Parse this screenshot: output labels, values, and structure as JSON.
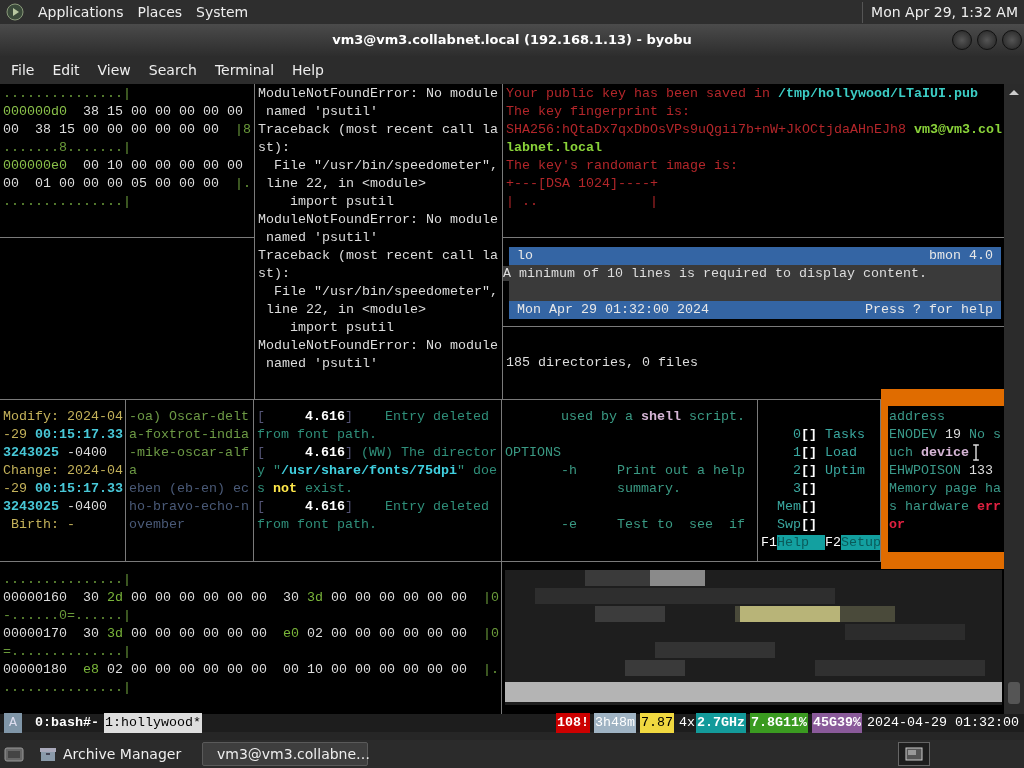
{
  "top_panel": {
    "menus": [
      "Applications",
      "Places",
      "System"
    ],
    "clock": "Mon Apr 29, 1:32 AM"
  },
  "window": {
    "title": "vm3@vm3.collabnet.local (192.168.1.13) - byobu"
  },
  "menu_bar": [
    "File",
    "Edit",
    "View",
    "Search",
    "Terminal",
    "Help"
  ],
  "panes": {
    "hexdump_top": {
      "lines": [
        "...............|",
        [
          {
            "text": "000000d0",
            "kind": "offset"
          },
          {
            "text": "  38 15 00 00 00 00 00",
            "kind": "hex"
          }
        ],
        [
          {
            "text": "00  38 15 00 00 00 00 00 00  ",
            "kind": "hex"
          },
          {
            "text": "|8",
            "kind": "ascii"
          }
        ],
        ".......8.......|",
        [
          {
            "text": "000000e0",
            "kind": "offset"
          },
          {
            "text": "  00 10 00 00 00 00 00",
            "kind": "hex"
          }
        ],
        [
          {
            "text": "00  01 00 00 00 05 00 00 00  ",
            "kind": "hex"
          },
          {
            "text": "|.",
            "kind": "ascii"
          }
        ],
        "...............|"
      ]
    },
    "python_errors": {
      "lines": [
        "ModuleNotFoundError: No module",
        " named 'psutil'",
        "Traceback (most recent call la",
        "st):",
        "  File \"/usr/bin/speedometer\",",
        " line 22, in <module>",
        "    import psutil",
        "ModuleNotFoundError: No module",
        " named 'psutil'",
        "Traceback (most recent call la",
        "st):",
        "  File \"/usr/bin/speedometer\",",
        " line 22, in <module>",
        "    import psutil",
        "ModuleNotFoundError: No module",
        " named 'psutil'"
      ]
    },
    "ssh_keygen": {
      "lines": [
        [
          {
            "text": "Your public key has been saved in ",
            "kind": "message"
          },
          {
            "text": "/tmp/hollywood/LTaIUI.pub",
            "kind": "path"
          }
        ],
        "The key fingerprint is:",
        [
          {
            "text": "SHA256:hQtaDx7qxDbOsVPs9uQgii7b+nW+JkOCtjdaAHnEJh8",
            "kind": "message"
          },
          {
            "text": " vm3@vm3.col",
            "kind": "user"
          }
        ],
        [
          {
            "text": "labnet.local",
            "kind": "user"
          }
        ],
        "The key's randomart image is:",
        "+---[DSA 1024]----+",
        "| ..              |"
      ]
    },
    "bmon": {
      "interface": "lo",
      "version": "bmon 4.0",
      "message": "A minimum of 10 lines is required to display content.",
      "timestamp": "Mon Apr 29 01:32:00 2024",
      "hint": "Press ? for help"
    },
    "tree": {
      "lines": [
        "185 directories, 0 files"
      ]
    },
    "stat": {
      "lines": [
        "Modify: 2024-04",
        [
          {
            "text": "-29 ",
            "kind": "date"
          },
          {
            "text": "00:15:17.33",
            "kind": "time"
          }
        ],
        [
          {
            "text": "3243025",
            "kind": "time"
          },
          {
            "text": " -0400",
            "kind": "plain"
          }
        ],
        "Change: 2024-04",
        [
          {
            "text": "-29 ",
            "kind": "date"
          },
          {
            "text": "00:15:17.33",
            "kind": "time"
          }
        ],
        [
          {
            "text": "3243025",
            "kind": "time"
          },
          {
            "text": " -0400",
            "kind": "plain"
          }
        ],
        " Birth: -"
      ]
    },
    "nato": {
      "lines": [
        "-oa) Oscar-delt",
        "a-foxtrot-india",
        "-mike-oscar-alf",
        "a",
        [
          {
            "text": "eben (eb-en) ec",
            "kind": "faded"
          }
        ],
        [
          {
            "text": "ho-bravo-echo-n",
            "kind": "faded"
          }
        ],
        [
          {
            "text": "ovember",
            "kind": "faded"
          }
        ]
      ]
    },
    "xorg_log": {
      "lines": [
        [
          {
            "text": "[",
            "kind": "bracket"
          },
          {
            "text": "     4.616",
            "kind": "stamp"
          },
          {
            "text": "]",
            "kind": "bracket"
          },
          {
            "text": "    Entry deleted",
            "kind": "log"
          }
        ],
        "from font path.",
        [
          {
            "text": "[",
            "kind": "bracket"
          },
          {
            "text": "     4.616",
            "kind": "stamp"
          },
          {
            "text": "]",
            "kind": "bracket"
          },
          {
            "text": " (WW) The director",
            "kind": "log"
          }
        ],
        [
          {
            "text": "y \"",
            "kind": "log"
          },
          {
            "text": "/usr/share/fonts/75dpi",
            "kind": "quoted"
          },
          {
            "text": "\" doe",
            "kind": "log"
          }
        ],
        [
          {
            "text": "s ",
            "kind": "log"
          },
          {
            "text": "not",
            "kind": "warn"
          },
          {
            "text": " exist.",
            "kind": "log"
          }
        ],
        [
          {
            "text": "[",
            "kind": "bracket"
          },
          {
            "text": "     4.616",
            "kind": "stamp"
          },
          {
            "text": "]",
            "kind": "bracket"
          },
          {
            "text": "    Entry deleted",
            "kind": "log"
          }
        ],
        "from font path."
      ]
    },
    "man_page": {
      "paragraphs": [
        [
          [
            {
              "text": "       used by a ",
              "kind": "man"
            },
            {
              "text": "shell",
              "kind": "keyword"
            },
            {
              "text": " script.",
              "kind": "man"
            }
          ]
        ],
        [
          "OPTIONS",
          "       -h     Print out a help",
          "              summary."
        ],
        [
          "       -e     Test to  see  if"
        ]
      ]
    },
    "htop": {
      "lines": [
        [
          {
            "text": "    0",
            "kind": "meter-label"
          },
          {
            "text": "[]",
            "kind": "meter"
          },
          {
            "text": " Tasks",
            "kind": "meter-label"
          }
        ],
        [
          {
            "text": "    1",
            "kind": "meter-label"
          },
          {
            "text": "[]",
            "kind": "meter"
          },
          {
            "text": " Load",
            "kind": "meter-label"
          }
        ],
        [
          {
            "text": "    2",
            "kind": "meter-label"
          },
          {
            "text": "[]",
            "kind": "meter"
          },
          {
            "text": " Uptim",
            "kind": "meter-label"
          }
        ],
        [
          {
            "text": "    3",
            "kind": "meter-label"
          },
          {
            "text": "[]",
            "kind": "meter"
          }
        ],
        [
          {
            "text": "  Mem",
            "kind": "meter-label"
          },
          {
            "text": "[]",
            "kind": "meter"
          }
        ],
        [
          {
            "text": "  Swp",
            "kind": "meter-label"
          },
          {
            "text": "[]",
            "kind": "meter"
          }
        ],
        [
          {
            "text": "F1",
            "kind": "fkey"
          },
          {
            "text": "Help  ",
            "kind": "fkey-label"
          },
          {
            "text": "F2",
            "kind": "fkey"
          },
          {
            "text": "Setup",
            "kind": "fkey-label"
          }
        ]
      ]
    },
    "errno": {
      "lines": [
        "address",
        [
          {
            "text": "ENODEV",
            "kind": "errno"
          },
          {
            "text": " 19 ",
            "kind": "plain"
          },
          {
            "text": "No s",
            "kind": "errno"
          }
        ],
        [
          {
            "text": "uch ",
            "kind": "errno"
          },
          {
            "text": "device",
            "kind": "keyword"
          }
        ],
        [
          {
            "text": "EHWPOISON",
            "kind": "errno"
          },
          {
            "text": " 133",
            "kind": "plain"
          }
        ],
        "Memory page ha",
        [
          {
            "text": "s hardware ",
            "kind": "errno"
          },
          {
            "text": "err",
            "kind": "alert"
          }
        ],
        [
          {
            "text": "or",
            "kind": "alert"
          }
        ]
      ]
    },
    "hexdump_bottom": {
      "lines": [
        [
          {
            "text": "...............|",
            "kind": "ascii"
          }
        ],
        [
          {
            "text": "00000160  30 ",
            "kind": "hex"
          },
          {
            "text": "2d",
            "kind": "hex-hi"
          },
          {
            "text": " 00 00 00 00 00 00  30 ",
            "kind": "hex"
          },
          {
            "text": "3d",
            "kind": "hex-hi"
          },
          {
            "text": " 00 00 00 00 00 00  ",
            "kind": "hex"
          },
          {
            "text": "|0",
            "kind": "ascii"
          }
        ],
        [
          {
            "text": "-......0=......|",
            "kind": "ascii"
          }
        ],
        [
          {
            "text": "00000170  30 ",
            "kind": "hex"
          },
          {
            "text": "3d",
            "kind": "hex-hi"
          },
          {
            "text": " 00 00 00 00 00 00  ",
            "kind": "hex"
          },
          {
            "text": "e0",
            "kind": "hex-hi"
          },
          {
            "text": " 02 00 00 00 00 00 00  ",
            "kind": "hex"
          },
          {
            "text": "|0",
            "kind": "ascii"
          }
        ],
        [
          {
            "text": "=..............|",
            "kind": "ascii"
          }
        ],
        [
          {
            "text": "00000180  ",
            "kind": "hex"
          },
          {
            "text": "e8",
            "kind": "hex-hi"
          },
          {
            "text": " 02 00 00 00 00 00 00  00 10 00 00 00 00 00 00  ",
            "kind": "hex"
          },
          {
            "text": "|.",
            "kind": "ascii"
          }
        ],
        [
          {
            "text": "...............|",
            "kind": "ascii"
          }
        ]
      ]
    }
  },
  "status_bar": {
    "session": "A",
    "windows": [
      {
        "label": "0:bash#-",
        "selected": false
      },
      {
        "label": "1:hollywood*",
        "selected": true
      }
    ],
    "indicators": [
      {
        "text": "108!",
        "kind": "alert"
      },
      {
        "text": "3h48m",
        "kind": "uptime"
      },
      {
        "text": "7.87",
        "kind": "load"
      },
      {
        "text": "4x",
        "kind": "plain"
      },
      {
        "text": "2.7GHz",
        "kind": "cpu"
      },
      {
        "text": "7.8G11%",
        "kind": "memory"
      },
      {
        "text": "45G39%",
        "kind": "disk"
      },
      {
        "text": "2024-04-29 01:32:00",
        "kind": "clock"
      }
    ]
  },
  "taskbar": {
    "tasks": [
      {
        "label": "Archive Manager",
        "selected": false
      },
      {
        "label": "vm3@vm3.collabne…",
        "selected": true
      }
    ]
  }
}
